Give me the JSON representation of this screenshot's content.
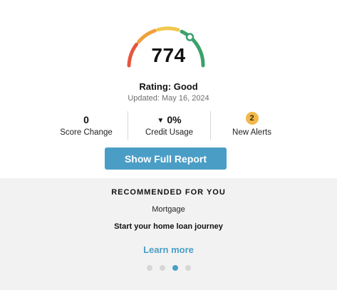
{
  "score": {
    "value": "774",
    "rating": "Rating: Good",
    "updated": "Updated: May 16, 2024",
    "gauge_colors": [
      "#e4573d",
      "#f0a13a",
      "#f2c84b",
      "#3aa16b"
    ]
  },
  "stats": [
    {
      "value": "0",
      "label": "Score Change"
    },
    {
      "value": "0%",
      "label": "Credit Usage",
      "arrow": "▼"
    },
    {
      "value": "2",
      "label": "New Alerts"
    }
  ],
  "actions": {
    "show_report": "Show Full Report"
  },
  "recommended": {
    "title": "RECOMMENDED FOR YOU",
    "category": "Mortgage",
    "description": "Start your home loan journey",
    "link": "Learn more"
  },
  "carousel": {
    "count": 4,
    "active": 3
  },
  "colors": {
    "accent": "#4a9ec6",
    "badge": "#f2b84b"
  }
}
